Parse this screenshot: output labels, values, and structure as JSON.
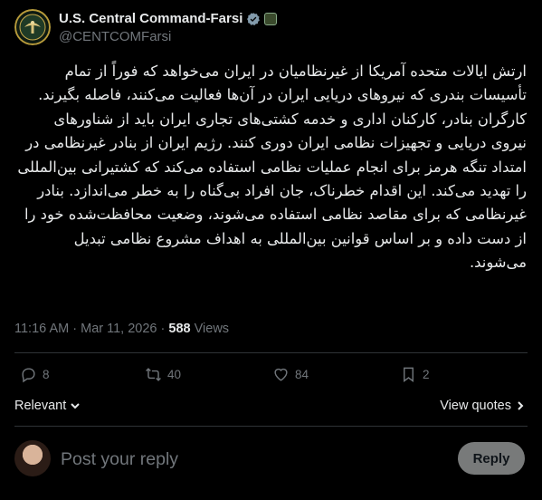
{
  "author": {
    "display_name": "U.S. Central Command-Farsi",
    "handle": "@CENTCOMFarsi",
    "avatar_icon": "centcom-seal-icon",
    "verified_icon": "verified-badge-icon",
    "affiliation_icon": "affiliate-badge-icon"
  },
  "tweet": {
    "text": "ارتش ایالات متحده آمریکا از غیرنظامیان در ایران می‌خواهد که فوراً از تمام تأسیسات بندری که نیروهای دریایی ایران در آن‌ها فعالیت می‌کنند، فاصله بگیرند. کارگران بنادر، کارکنان اداری و خدمه کشتی‌های تجاری ایران باید از شناورهای نیروی دریایی و تجهیزات نظامی ایران دوری کنند. رژیم ایران از بنادر غیرنظامی در امتداد تنگه هرمز برای انجام عملیات نظامی استفاده می‌کند که کشتیرانی بین‌المللی را تهدید می‌کند. این اقدام خطرناک، جان افراد بی‌گناه را به خطر می‌اندازد. بنادر غیرنظامی که برای مقاصد نظامی استفاده می‌شوند، وضعیت محافظت‌شده خود را از دست داده و بر اساس قوانین بین‌المللی به اهداف مشروع نظامی تبدیل می‌شوند.",
    "time": "11:16 AM",
    "separator": "·",
    "date": "Mar 11, 2026",
    "views_count": "588",
    "views_label": "Views"
  },
  "actions": {
    "replies": "8",
    "reposts": "40",
    "likes": "84",
    "bookmarks": "2"
  },
  "sort": {
    "relevant_label": "Relevant",
    "view_quotes_label": "View quotes"
  },
  "reply": {
    "placeholder": "Post your reply",
    "button_label": "Reply"
  },
  "colors": {
    "background": "#000000",
    "text": "#e7e9ea",
    "muted": "#71767b",
    "divider": "#2f3336",
    "verified": "#829aab",
    "reply_button": "#787a7a"
  }
}
